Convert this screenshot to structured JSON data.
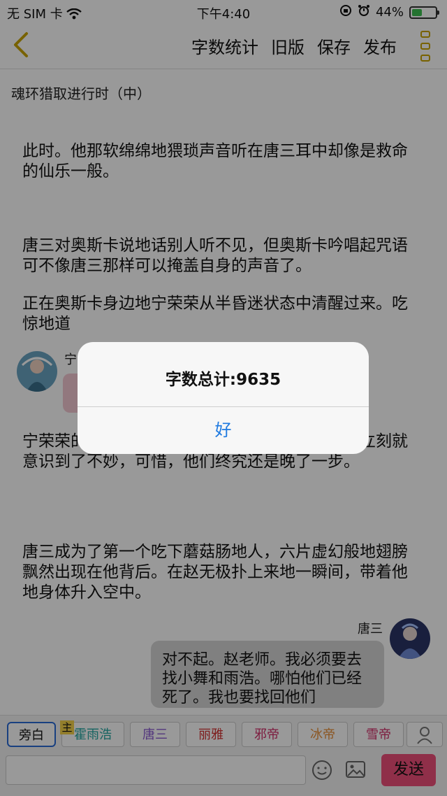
{
  "status_bar": {
    "carrier": "无 SIM 卡",
    "time": "下午4:40",
    "battery_text": "44%",
    "battery_level": 0.44
  },
  "nav": {
    "actions": [
      "字数统计",
      "旧版",
      "保存",
      "发布"
    ]
  },
  "chapter_title": "魂环猎取进行时（中）",
  "paragraphs": [
    "此时。他那软绵绵地猥琐声音听在唐三耳中却像是救命的仙乐一般。",
    "唐三对奥斯卡说地话别人听不见，但奥斯卡吟唱起咒语可不像唐三那样可以掩盖自身的声音了。",
    "正在奥斯卡身边地宁荣荣从半昏迷状态中清醒过来。吃惊地道",
    "宁荣荣的声音刚一响起，赵无极也是聪明人，他立刻就意识到了不妙，可惜，他们终究还是晚了一步。",
    "唐三成为了第一个吃下蘑菇肠地人，六片虚幻般地翅膀飘然出现在他背后。在赵无极扑上来地一瞬间，带着他地身体升入空中。"
  ],
  "chat": {
    "left_name": "宁",
    "right_name": "唐三",
    "right_message": "对不起。赵老师。我必须要去找小舞和雨浩。哪怕他们已经死了。我也要找回他们"
  },
  "roles": [
    {
      "label": "旁白",
      "color": "#111111"
    },
    {
      "label": "霍雨浩",
      "color": "#22a6a0"
    },
    {
      "label": "唐三",
      "color": "#8a5bd0"
    },
    {
      "label": "丽雅",
      "color": "#d23030"
    },
    {
      "label": "邪帝",
      "color": "#d0306a"
    },
    {
      "label": "冰帝",
      "color": "#e8903a"
    },
    {
      "label": "雪帝",
      "color": "#d0306a"
    }
  ],
  "master_badge": "主",
  "send_label": "发送",
  "dialog": {
    "title": "字数总计:9635",
    "button": "好"
  }
}
